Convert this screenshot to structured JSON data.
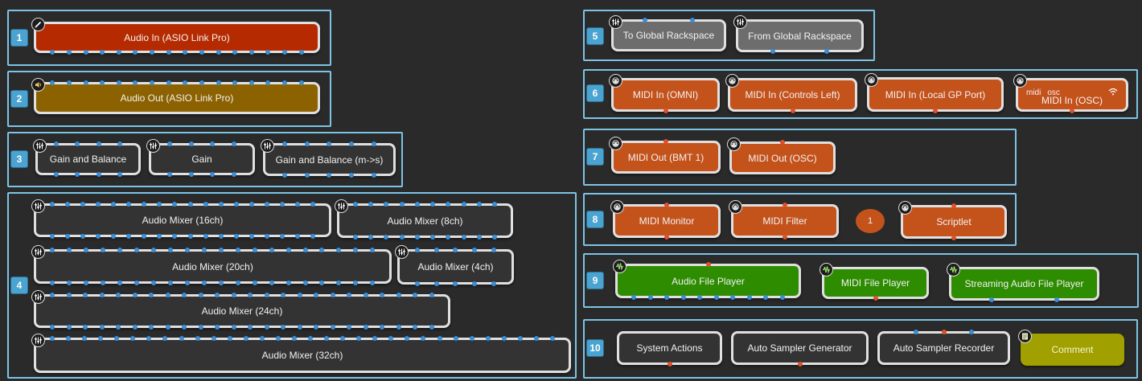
{
  "colors": {
    "group_border": "#7cc4e6",
    "group_number_bg": "#4aa3d0",
    "plugin_dark": "#333333",
    "plugin_gray": "#6d6d6d",
    "plugin_orange": "#c4521b",
    "plugin_red": "#b52a00",
    "plugin_brown": "#8c6200",
    "plugin_green": "#2d8c00",
    "plugin_olive": "#a0a000",
    "audio_pin": "#3a8ed6",
    "midi_pin": "#e0502a"
  },
  "groups": [
    {
      "number": "1",
      "plugins": [
        {
          "label": "Audio In (ASIO Link Pro)",
          "icon": "pencil-icon"
        }
      ]
    },
    {
      "number": "2",
      "plugins": [
        {
          "label": "Audio Out (ASIO Link Pro)",
          "icon": "speaker-icon"
        }
      ]
    },
    {
      "number": "3",
      "plugins": [
        {
          "label": "Gain and Balance",
          "icon": "sliders-icon"
        },
        {
          "label": "Gain",
          "icon": "sliders-icon"
        },
        {
          "label": "Gain and Balance (m->s)",
          "icon": "sliders-icon"
        }
      ]
    },
    {
      "number": "4",
      "plugins": [
        {
          "label": "Audio Mixer (16ch)",
          "icon": "sliders-icon"
        },
        {
          "label": "Audio Mixer (8ch)",
          "icon": "sliders-icon"
        },
        {
          "label": "Audio Mixer (20ch)",
          "icon": "sliders-icon"
        },
        {
          "label": "Audio Mixer (4ch)",
          "icon": "sliders-icon"
        },
        {
          "label": "Audio Mixer (24ch)",
          "icon": "sliders-icon"
        },
        {
          "label": "Audio Mixer (32ch)",
          "icon": "sliders-icon"
        }
      ]
    },
    {
      "number": "5",
      "plugins": [
        {
          "label": "To Global Rackspace",
          "icon": "sliders-icon"
        },
        {
          "label": "From Global Rackspace",
          "icon": "sliders-icon"
        }
      ]
    },
    {
      "number": "6",
      "plugins": [
        {
          "label": "MIDI In (OMNI)",
          "icon": "midi-icon"
        },
        {
          "label": "MIDI In (Controls Left)",
          "icon": "midi-icon"
        },
        {
          "label": "MIDI In (Local GP Port)",
          "icon": "midi-icon"
        },
        {
          "label": "MIDI In (OSC)",
          "icon": "midi-icon",
          "tags": [
            "midi",
            "osc"
          ],
          "status_icon": "wifi-icon"
        }
      ]
    },
    {
      "number": "7",
      "plugins": [
        {
          "label": "MIDI Out (BMT 1)",
          "icon": "midi-icon"
        },
        {
          "label": "MIDI Out (OSC)",
          "icon": "midi-icon"
        }
      ]
    },
    {
      "number": "8",
      "plugins": [
        {
          "label": "MIDI Monitor",
          "icon": "midi-icon"
        },
        {
          "label": "MIDI Filter",
          "icon": "midi-icon"
        },
        {
          "label": "Scriptlet",
          "icon": "midi-icon"
        }
      ],
      "badge": "1"
    },
    {
      "number": "9",
      "plugins": [
        {
          "label": "Audio File Player",
          "icon": "waveform-icon"
        },
        {
          "label": "MIDI File Player",
          "icon": "waveform-icon"
        },
        {
          "label": "Streaming Audio File Player",
          "icon": "waveform-icon"
        }
      ]
    },
    {
      "number": "10",
      "plugins": [
        {
          "label": "System Actions"
        },
        {
          "label": "Auto Sampler Generator"
        },
        {
          "label": "Auto Sampler Recorder"
        },
        {
          "label": "Comment",
          "icon": "note-icon"
        }
      ]
    }
  ]
}
